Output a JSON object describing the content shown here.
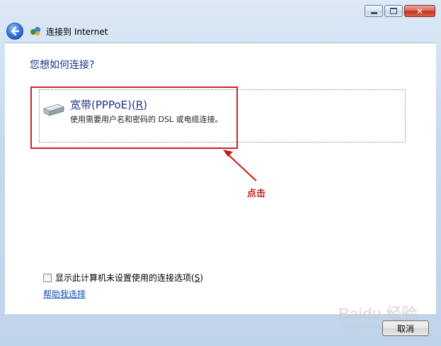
{
  "window": {
    "title": "连接到 Internet",
    "caption_minimize": "minimize",
    "caption_maximize": "maximize",
    "caption_close": "✕"
  },
  "heading": "您想如何连接?",
  "option": {
    "title": "宽带(PPPoE)(",
    "title_key": "R",
    "title_close": ")",
    "description": "使用需要用户名和密码的 DSL 或电缆连接。"
  },
  "annotation": {
    "label": "点击",
    "color": "#c21b17"
  },
  "checkbox": {
    "label": "显示此计算机未设置使用的连接选项(",
    "key": "S",
    "label_close": ")",
    "checked": false
  },
  "help_link": "帮助我选择",
  "cancel_button": "取消",
  "watermark": {
    "main": "Baidu 经验",
    "sub": "jingyan.baidu.com"
  },
  "colors": {
    "heading": "#1e3287",
    "link": "#0b4fb4",
    "annotation_box": "#d42020"
  }
}
